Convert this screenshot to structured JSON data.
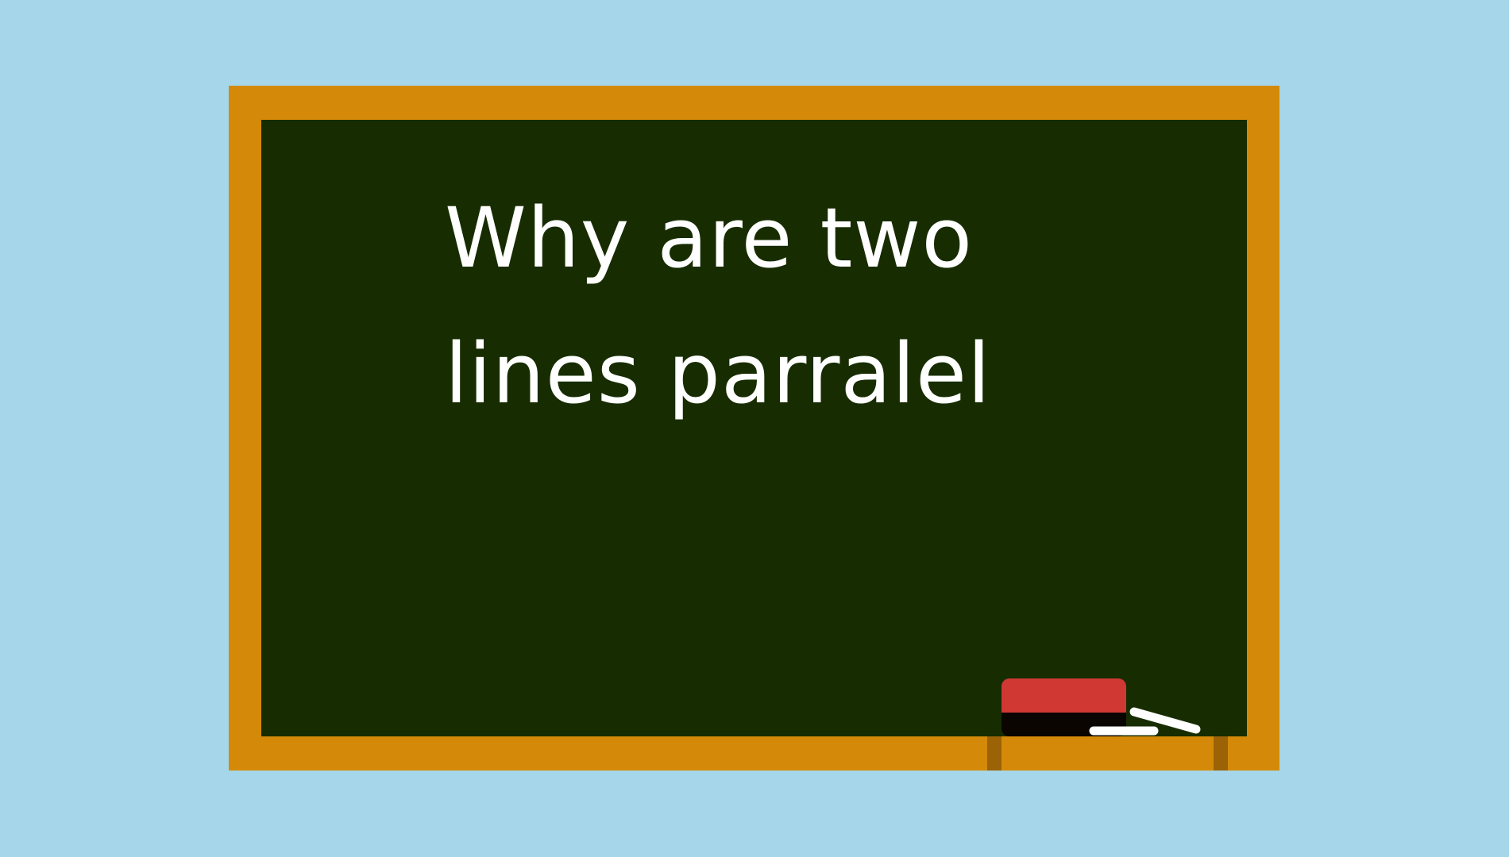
{
  "colors": {
    "background": "#a6d6e9",
    "frame": "#d48a08",
    "board": "#172d01",
    "tray_bracket": "#9c6206",
    "eraser_felt": "#cf3833",
    "eraser_base": "#0a0500",
    "chalk": "#ffffff"
  },
  "board": {
    "message": "Why are two\nlines parralel"
  },
  "icons": {
    "eraser": "eraser-icon",
    "chalk": "chalk-icon"
  }
}
